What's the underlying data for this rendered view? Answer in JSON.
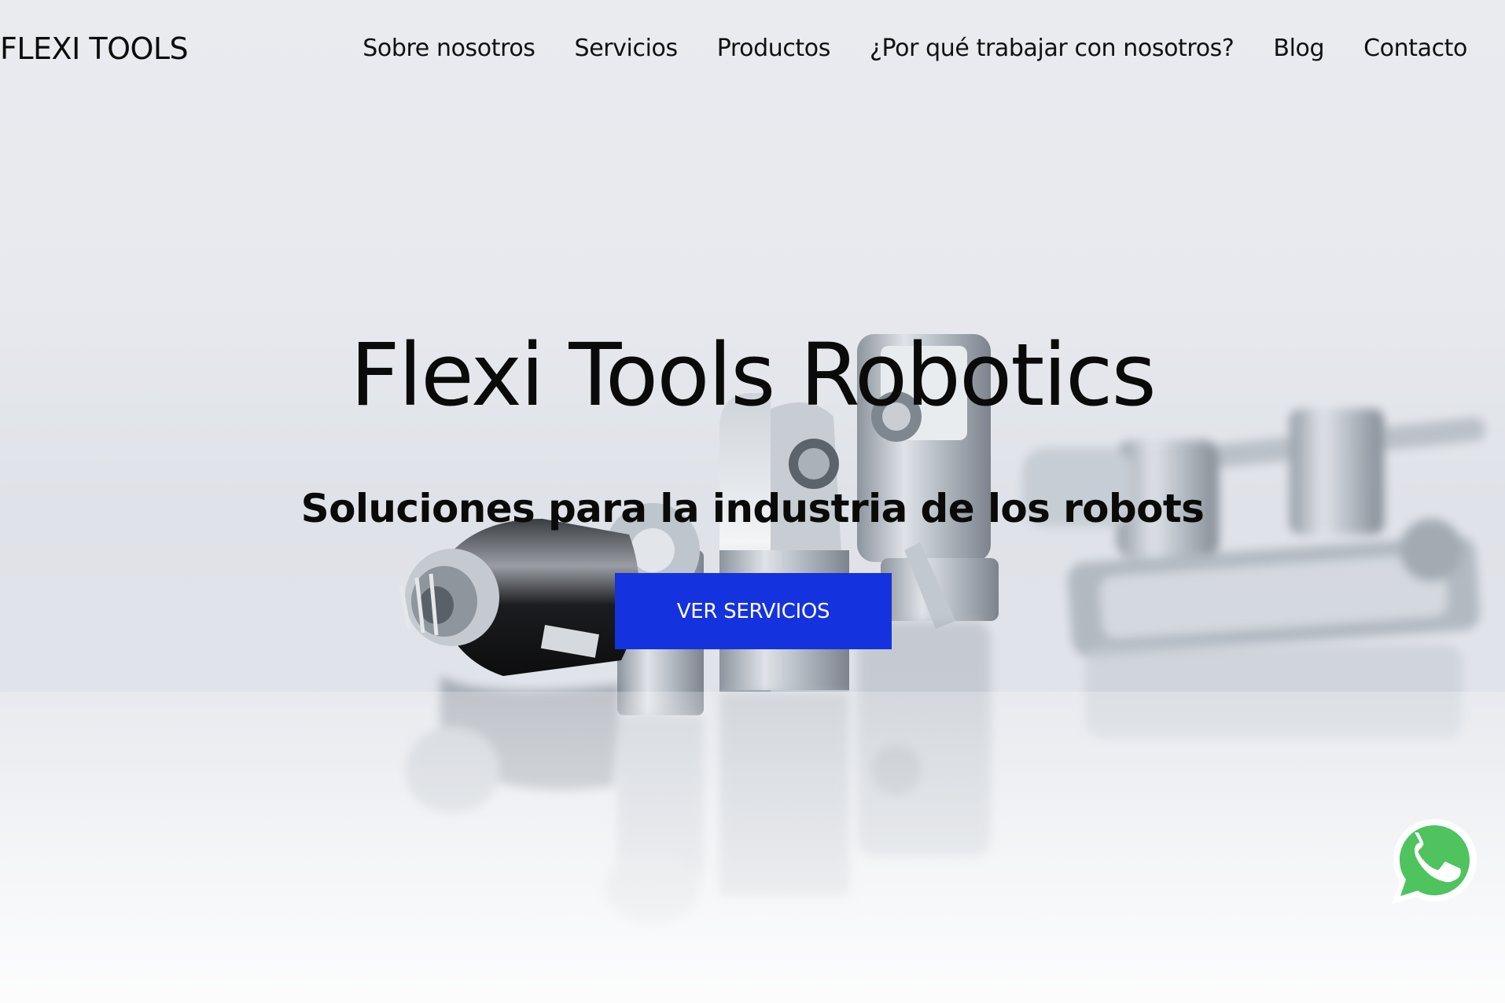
{
  "header": {
    "logo_text": "FLEXI TOOLS",
    "nav": [
      {
        "label": "Sobre nosotros"
      },
      {
        "label": "Servicios"
      },
      {
        "label": "Productos"
      },
      {
        "label": "¿Por qué trabajar con nosotros?"
      },
      {
        "label": "Blog"
      },
      {
        "label": "Contacto"
      }
    ]
  },
  "hero": {
    "title": "Flexi Tools Robotics",
    "subtitle": "Soluciones para la industria de los robots",
    "cta_label": "VER SERVICIOS",
    "background_image": "metal-robot-parts-photo"
  },
  "floating": {
    "whatsapp_icon": "whatsapp-icon"
  },
  "colors": {
    "cta_background": "#1532df",
    "cta_text": "#ffffff",
    "whatsapp_green": "#4ec35e",
    "text_primary": "#0a0a0a"
  }
}
